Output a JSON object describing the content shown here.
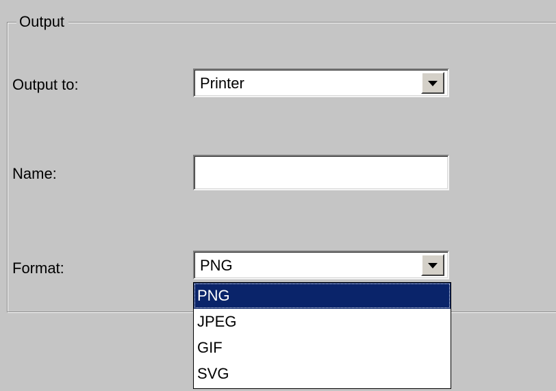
{
  "group": {
    "title": "Output"
  },
  "output_to": {
    "label": "Output to:",
    "value": "Printer"
  },
  "name_field": {
    "label": "Name:",
    "value": ""
  },
  "format": {
    "label": "Format:",
    "value": "PNG",
    "options": [
      {
        "label": "PNG",
        "selected": true
      },
      {
        "label": "JPEG",
        "selected": false
      },
      {
        "label": "GIF",
        "selected": false
      },
      {
        "label": "SVG",
        "selected": false
      }
    ]
  },
  "icons": {
    "dropdown_arrow": "chevron-down-icon"
  },
  "colors": {
    "background": "#c5c5c5",
    "selection": "#0a246a"
  }
}
